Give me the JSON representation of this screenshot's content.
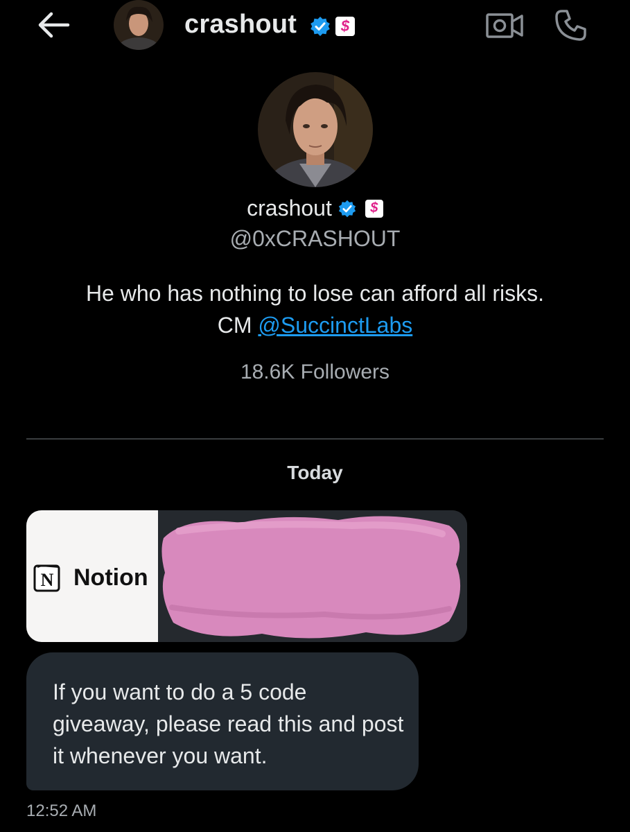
{
  "header": {
    "name": "crashout",
    "back_icon": "arrow-left-icon",
    "video_icon": "video-camera-icon",
    "phone_icon": "phone-icon"
  },
  "profile": {
    "name": "crashout",
    "handle": "@0xCRASHOUT",
    "bio_line1": "He who has nothing to lose can afford all risks.",
    "bio_prefix": "CM ",
    "bio_link": "@SuccinctLabs",
    "followers": "18.6K Followers"
  },
  "badges": {
    "verified_color": "#1d9bf0",
    "affiliate_symbol": "$",
    "affiliate_color": "#e0218a"
  },
  "conversation": {
    "day_label": "Today",
    "link_card": {
      "brand": "Notion",
      "logo_letter": "N",
      "redaction_color": "#d889bd"
    },
    "message": "If you want to do a 5 code giveaway, please read this and post it whenever you want.",
    "time": "12:52 AM"
  }
}
